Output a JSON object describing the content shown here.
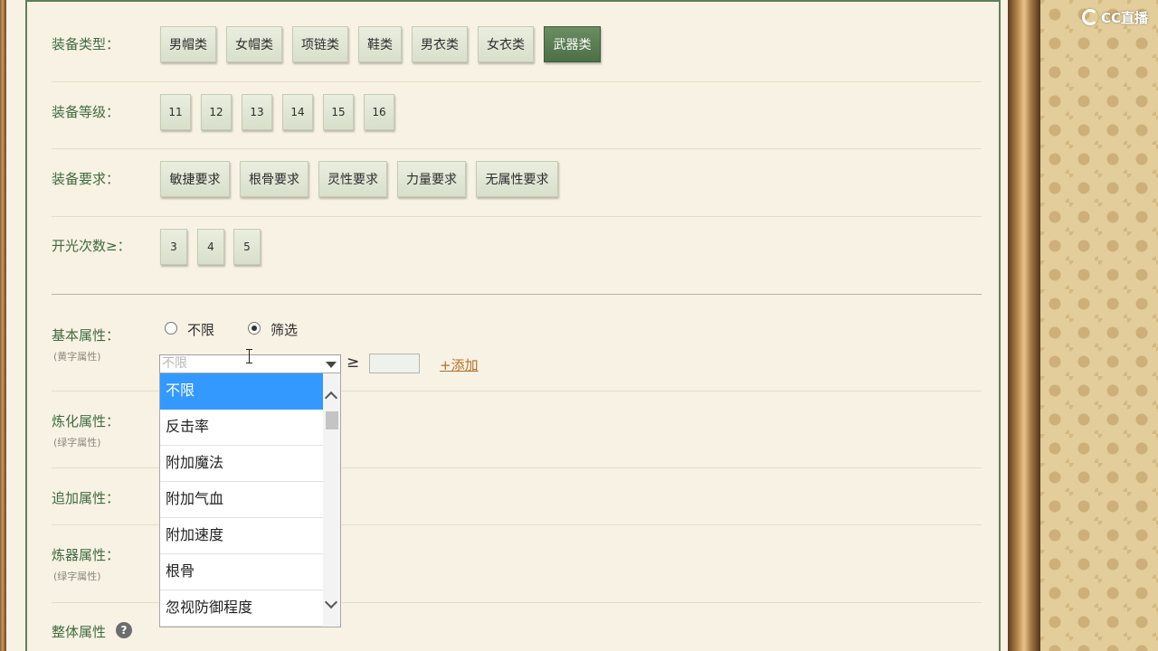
{
  "brand": {
    "logo_text": "CC直播"
  },
  "filters": {
    "equip_type": {
      "label": "装备类型：",
      "options": [
        "男帽类",
        "女帽类",
        "项链类",
        "鞋类",
        "男衣类",
        "女衣类",
        "武器类"
      ],
      "selected": "武器类"
    },
    "equip_level": {
      "label": "装备等级：",
      "options": [
        "11",
        "12",
        "13",
        "14",
        "15",
        "16"
      ]
    },
    "equip_req": {
      "label": "装备要求：",
      "options": [
        "敏捷要求",
        "根骨要求",
        "灵性要求",
        "力量要求",
        "无属性要求"
      ]
    },
    "open_count": {
      "label": "开光次数≥：",
      "options": [
        "3",
        "4",
        "5"
      ]
    }
  },
  "basic_attr": {
    "label": "基本属性：",
    "sublabel": "(黄字属性)",
    "radio": {
      "unlimited": "不限",
      "filter": "筛选",
      "selected": "筛选"
    },
    "select_placeholder": "不限",
    "ge_symbol": "≥",
    "add_link": "+添加",
    "dropdown": [
      "不限",
      "反击率",
      "附加魔法",
      "附加气血",
      "附加速度",
      "根骨",
      "忽视防御程度"
    ],
    "dropdown_active": "不限"
  },
  "refine_attr": {
    "label": "炼化属性：",
    "sublabel": "(绿字属性)"
  },
  "extra_attr": {
    "label": "追加属性："
  },
  "forge_attr": {
    "label": "炼器属性：",
    "sublabel": "(绿字属性)"
  },
  "overall_attr": {
    "label": "整体属性",
    "help": "?"
  },
  "colors": {
    "label_green": "#3f6b3f",
    "selected_green": "#4d6f46",
    "dropdown_highlight": "#3399ff",
    "link_orange": "#b0702a"
  }
}
